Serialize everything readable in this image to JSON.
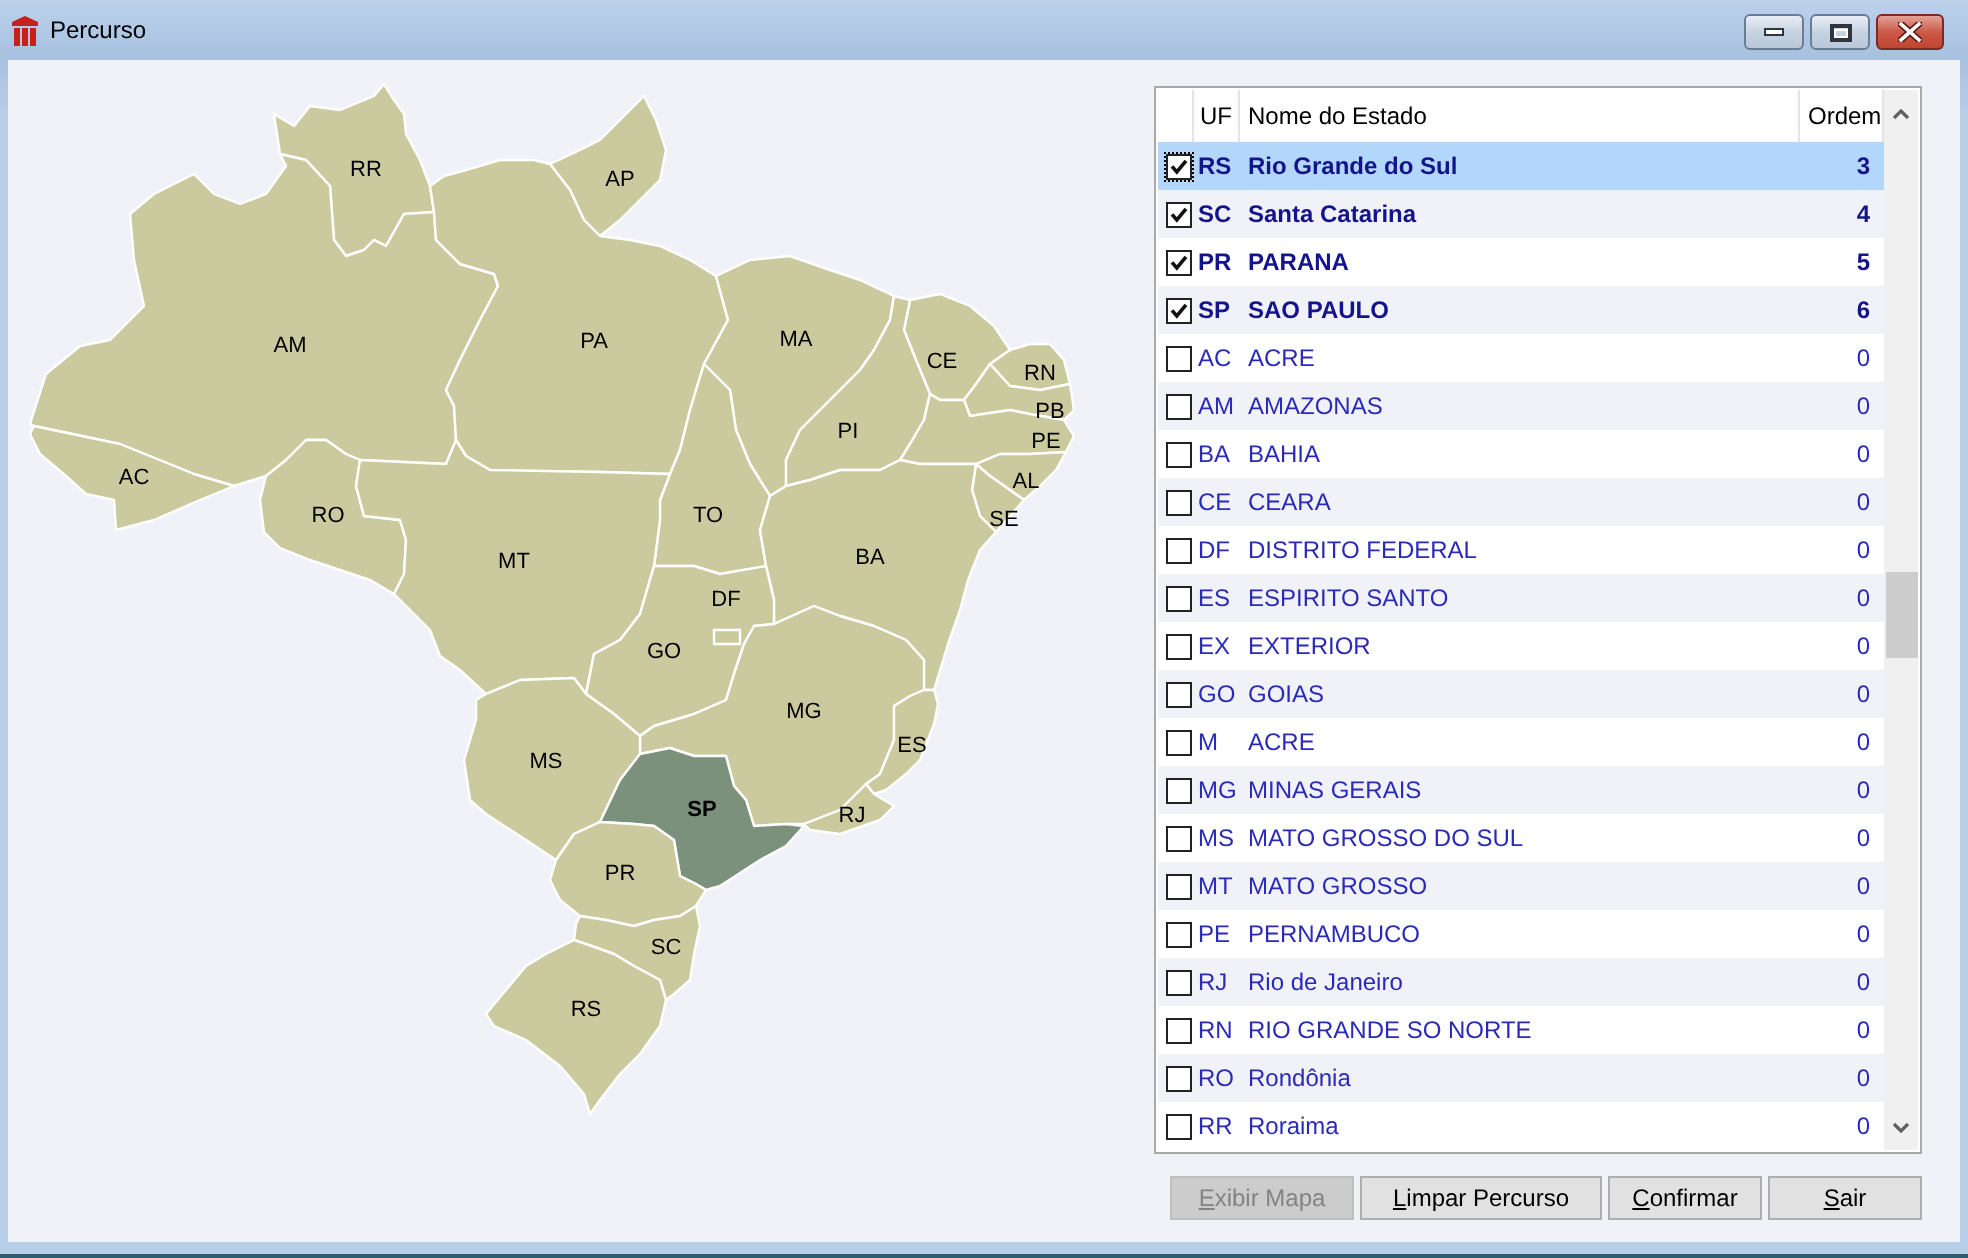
{
  "window": {
    "title": "Percurso"
  },
  "map": {
    "states": [
      {
        "label": "RR",
        "selected": false
      },
      {
        "label": "AP",
        "selected": false
      },
      {
        "label": "AM",
        "selected": false
      },
      {
        "label": "PA",
        "selected": false
      },
      {
        "label": "MA",
        "selected": false
      },
      {
        "label": "CE",
        "selected": false
      },
      {
        "label": "RN",
        "selected": false
      },
      {
        "label": "PB",
        "selected": false
      },
      {
        "label": "PI",
        "selected": false
      },
      {
        "label": "PE",
        "selected": false
      },
      {
        "label": "AC",
        "selected": false
      },
      {
        "label": "AL",
        "selected": false
      },
      {
        "label": "RO",
        "selected": false
      },
      {
        "label": "TO",
        "selected": false
      },
      {
        "label": "SE",
        "selected": false
      },
      {
        "label": "MT",
        "selected": false
      },
      {
        "label": "BA",
        "selected": false
      },
      {
        "label": "DF",
        "selected": false
      },
      {
        "label": "GO",
        "selected": false
      },
      {
        "label": "MG",
        "selected": false
      },
      {
        "label": "ES",
        "selected": false
      },
      {
        "label": "MS",
        "selected": false
      },
      {
        "label": "SP",
        "selected": true
      },
      {
        "label": "RJ",
        "selected": false
      },
      {
        "label": "PR",
        "selected": false
      },
      {
        "label": "SC",
        "selected": false
      },
      {
        "label": "RS",
        "selected": false
      }
    ]
  },
  "table": {
    "columns": [
      "UF",
      "Nome do Estado",
      "Ordem"
    ],
    "rows": [
      {
        "checked": true,
        "selected": true,
        "uf": "RS",
        "name": "Rio Grande do Sul",
        "order": "3"
      },
      {
        "checked": true,
        "selected": false,
        "uf": "SC",
        "name": "Santa Catarina",
        "order": "4"
      },
      {
        "checked": true,
        "selected": false,
        "uf": "PR",
        "name": "PARANA",
        "order": "5"
      },
      {
        "checked": true,
        "selected": false,
        "uf": "SP",
        "name": "SAO PAULO",
        "order": "6"
      },
      {
        "checked": false,
        "selected": false,
        "uf": "AC",
        "name": "ACRE",
        "order": "0"
      },
      {
        "checked": false,
        "selected": false,
        "uf": "AM",
        "name": "AMAZONAS",
        "order": "0"
      },
      {
        "checked": false,
        "selected": false,
        "uf": "BA",
        "name": "BAHIA",
        "order": "0"
      },
      {
        "checked": false,
        "selected": false,
        "uf": "CE",
        "name": "CEARA",
        "order": "0"
      },
      {
        "checked": false,
        "selected": false,
        "uf": "DF",
        "name": "DISTRITO FEDERAL",
        "order": "0"
      },
      {
        "checked": false,
        "selected": false,
        "uf": "ES",
        "name": "ESPIRITO SANTO",
        "order": "0"
      },
      {
        "checked": false,
        "selected": false,
        "uf": "EX",
        "name": "EXTERIOR",
        "order": "0"
      },
      {
        "checked": false,
        "selected": false,
        "uf": "GO",
        "name": "GOIAS",
        "order": "0"
      },
      {
        "checked": false,
        "selected": false,
        "uf": "M",
        "name": "ACRE",
        "order": "0"
      },
      {
        "checked": false,
        "selected": false,
        "uf": "MG",
        "name": "MINAS GERAIS",
        "order": "0"
      },
      {
        "checked": false,
        "selected": false,
        "uf": "MS",
        "name": "MATO GROSSO DO SUL",
        "order": "0"
      },
      {
        "checked": false,
        "selected": false,
        "uf": "MT",
        "name": "MATO GROSSO",
        "order": "0"
      },
      {
        "checked": false,
        "selected": false,
        "uf": "PE",
        "name": "PERNAMBUCO",
        "order": "0"
      },
      {
        "checked": false,
        "selected": false,
        "uf": "RJ",
        "name": "Rio de Janeiro",
        "order": "0"
      },
      {
        "checked": false,
        "selected": false,
        "uf": "RN",
        "name": "RIO GRANDE SO NORTE",
        "order": "0"
      },
      {
        "checked": false,
        "selected": false,
        "uf": "RO",
        "name": "Rondônia",
        "order": "0"
      },
      {
        "checked": false,
        "selected": false,
        "uf": "RR",
        "name": "Roraima",
        "order": "0"
      }
    ]
  },
  "buttons": [
    {
      "label": "Exibir Mapa",
      "disabled": true
    },
    {
      "label": "Limpar Percurso",
      "disabled": false
    },
    {
      "label": "Confirmar",
      "disabled": false
    },
    {
      "label": "Sair",
      "disabled": false
    }
  ]
}
